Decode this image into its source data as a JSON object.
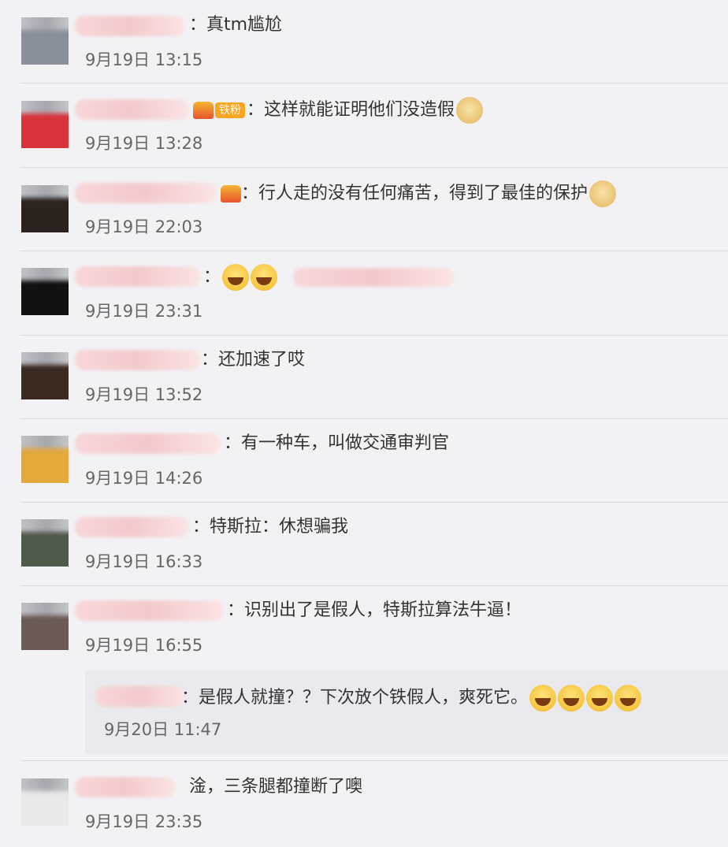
{
  "colors": {
    "background": "#f2f2f5",
    "text": "#333333",
    "time": "#666666",
    "divider": "#d9d9de"
  },
  "comments": [
    {
      "text": "：真tm尴尬",
      "time": "9月19日 13:15"
    },
    {
      "badge": "铁粉",
      "text": "：这样就能证明他们没造假",
      "emoji": "doge",
      "time": "9月19日 13:28"
    },
    {
      "text": "：行人走的没有任何痛苦，得到了最佳的保护",
      "emoji": "doge",
      "time": "9月19日 22:03"
    },
    {
      "text": "：",
      "emoji": "laugh",
      "time": "9月19日 23:31"
    },
    {
      "text": "：还加速了哎",
      "time": "9月19日 13:52"
    },
    {
      "text": "：有一种车，叫做交通审判官",
      "time": "9月19日 14:26"
    },
    {
      "text": "：特斯拉：休想骗我",
      "time": "9月19日 16:33"
    },
    {
      "text": "：识别出了是假人，特斯拉算法牛逼！",
      "time": "9月19日 16:55"
    },
    {
      "text": "淦，三条腿都撞断了噢",
      "time": "9月19日 23:35"
    }
  ],
  "reply": {
    "text": "：是假人就撞？？下次放个铁假人，爽死它。",
    "time": "9月20日 11:47"
  }
}
